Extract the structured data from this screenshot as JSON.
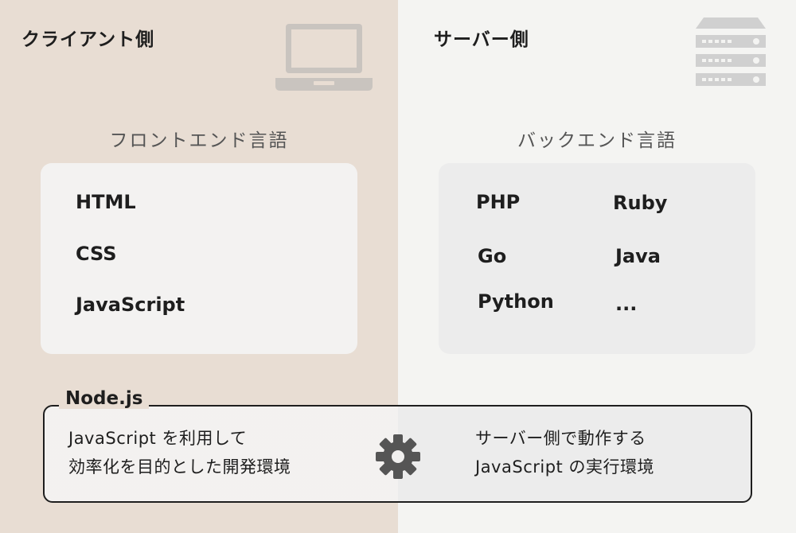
{
  "client": {
    "title": "クライアント側",
    "section_title": "フロントエンド言語",
    "languages": [
      "HTML",
      "CSS",
      "JavaScript"
    ]
  },
  "server": {
    "title": "サーバー側",
    "section_title": "バックエンド言語",
    "languages": [
      "PHP",
      "Ruby",
      "Go",
      "Java",
      "Python",
      "..."
    ]
  },
  "node": {
    "label": "Node.js",
    "left_line1": "JavaScript を利用して",
    "left_line2": "効率化を目的とした開発環境",
    "right_line1": "サーバー側で動作する",
    "right_line2": "JavaScript の実行環境"
  },
  "icons": {
    "laptop": "laptop-icon",
    "server": "server-icon",
    "gear": "gear-icon"
  },
  "colors": {
    "client_bg": "#e8ddd3",
    "server_bg": "#f4f4f2",
    "box_bg": "#f3f2f1",
    "icon_gray": "#c9c4bf",
    "gear": "#555555"
  }
}
